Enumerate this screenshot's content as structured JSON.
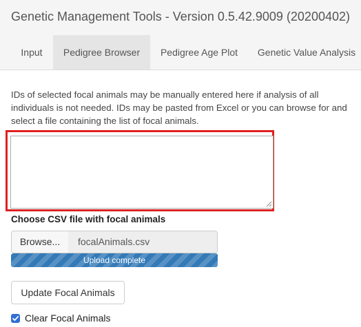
{
  "app": {
    "title": "Genetic Management Tools - Version 0.5.42.9009 (20200402)"
  },
  "tabs": [
    {
      "label": "Input",
      "active": false
    },
    {
      "label": "Pedigree Browser",
      "active": true
    },
    {
      "label": "Pedigree Age Plot",
      "active": false
    },
    {
      "label": "Genetic Value Analysis",
      "active": false
    }
  ],
  "focal": {
    "help_text": "IDs of selected focal animals may be manually entered here if analysis of all individuals is not needed. IDs may be pasted from Excel or you can browse for and select a file containing the list of focal animals.",
    "textarea_value": "",
    "highlight_color": "#e02020"
  },
  "file_input": {
    "label": "Choose CSV file with focal animals",
    "browse_label": "Browse...",
    "file_name": "focalAnimals.csv",
    "progress_text": "Upload complete",
    "progress_fraction": 1.0,
    "progress_color": "#337ab7"
  },
  "actions": {
    "update_label": "Update Focal Animals"
  },
  "clear_option": {
    "label": "Clear Focal Animals",
    "checked": true,
    "color": "#2f6fd6"
  }
}
